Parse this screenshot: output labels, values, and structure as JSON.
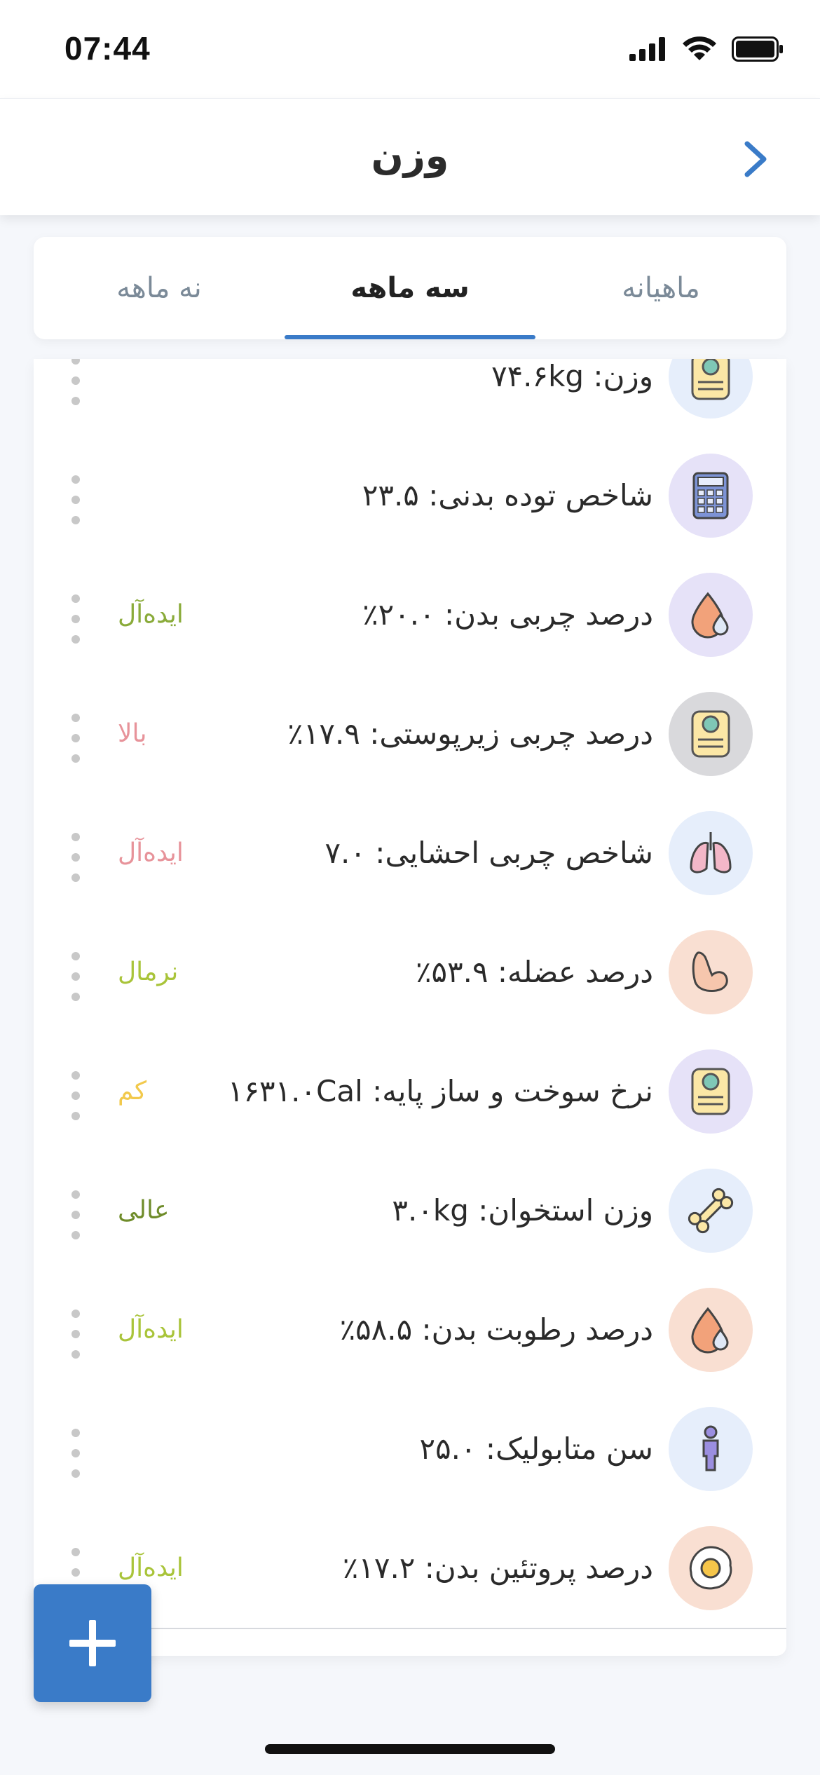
{
  "status_bar": {
    "time": "07:44"
  },
  "header": {
    "title": "وزن"
  },
  "tabs": [
    {
      "label": "ماهیانه",
      "active": false
    },
    {
      "label": "سه ماهه",
      "active": true
    },
    {
      "label": "نه ماهه",
      "active": false
    }
  ],
  "items": [
    {
      "title": "وزن: ۷۴.۶kg",
      "status": "",
      "icon": "scale-icon"
    },
    {
      "title": "شاخص توده بدنی: ۲۳.۵",
      "status": "",
      "icon": "calculator-icon"
    },
    {
      "title": "درصد چربی بدن: ۲۰.۰٪",
      "status": "ایده‌آل",
      "icon": "drop-icon"
    },
    {
      "title": "درصد چربی زیرپوستی: ۱۷.۹٪",
      "status": "بالا",
      "icon": "scale-icon"
    },
    {
      "title": "شاخص چربی احشایی: ۷.۰",
      "status": "ایده‌آل",
      "icon": "lungs-icon"
    },
    {
      "title": "درصد عضله: ۵۳.۹٪",
      "status": "نرمال",
      "icon": "muscle-icon"
    },
    {
      "title": "نرخ سوخت و ساز پایه: ۱۶۳۱.۰Cal",
      "status": "کم",
      "icon": "scale-icon"
    },
    {
      "title": "وزن استخوان: ۳.۰kg",
      "status": "عالی",
      "icon": "bone-icon"
    },
    {
      "title": "درصد رطوبت بدن: ۵۸.۵٪",
      "status": "ایده‌آل",
      "icon": "drop-icon"
    },
    {
      "title": "سن متابولیک: ۲۵.۰",
      "status": "",
      "icon": "person-icon"
    },
    {
      "title": "درصد پروتئین بدن: ۱۷.۲٪",
      "status": "ایده‌آل",
      "icon": "egg-icon"
    }
  ],
  "colors": {
    "accent": "#3a7bc8",
    "status_ideal_green": "#8aab3a",
    "status_ideal_pink": "#e7939a",
    "status_high": "#e7939a",
    "status_normal": "#a9c43a",
    "status_low": "#f2c94c",
    "status_excellent": "#6f8c2a"
  },
  "fab": {
    "label": "+"
  }
}
